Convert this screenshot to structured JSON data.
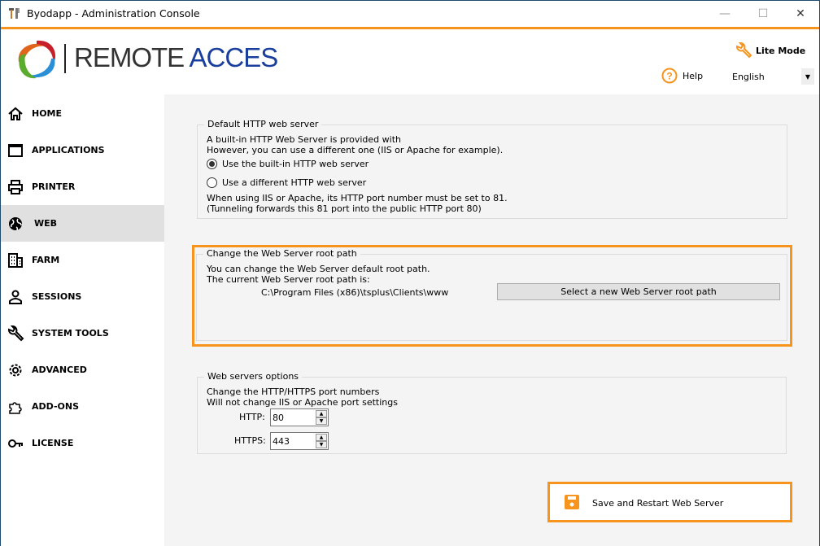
{
  "window": {
    "title": "Byodapp - Administration Console",
    "minimize": "—",
    "maximize": "☐",
    "close": "✕"
  },
  "header": {
    "logo_text_dark": "REMOTE",
    "logo_text_blue": "ACCES",
    "lite_mode": "Lite Mode",
    "help": "Help",
    "language": "English",
    "accent": "#f7941d"
  },
  "sidebar": {
    "items": [
      {
        "label": "HOME",
        "icon": "home-icon"
      },
      {
        "label": "APPLICATIONS",
        "icon": "window-icon"
      },
      {
        "label": "PRINTER",
        "icon": "printer-icon"
      },
      {
        "label": "WEB",
        "icon": "globe-icon",
        "selected": true
      },
      {
        "label": "FARM",
        "icon": "building-icon"
      },
      {
        "label": "SESSIONS",
        "icon": "user-icon"
      },
      {
        "label": "SYSTEM TOOLS",
        "icon": "wrench-icon"
      },
      {
        "label": "ADVANCED",
        "icon": "gear-icon"
      },
      {
        "label": "ADD-ONS",
        "icon": "puzzle-icon"
      },
      {
        "label": "LICENSE",
        "icon": "key-icon"
      }
    ]
  },
  "default_server": {
    "legend": "Default HTTP web server",
    "line1": "A built-in HTTP Web Server is provided with",
    "line2": "However, you can use a different one (IIS or Apache for example).",
    "radio_builtin": "Use the built-in HTTP web server",
    "radio_different": "Use a different HTTP web server",
    "selected": "builtin",
    "note1": "When using IIS or Apache, its HTTP port number must be set to 81.",
    "note2": "(Tunneling forwards this 81 port into the public HTTP port 80)"
  },
  "root_path": {
    "legend": "Change the Web Server root path",
    "line1": "You can change the Web Server default root path.",
    "line2": "The current Web Server root path is:",
    "path": "C:\\Program Files (x86)\\tsplus\\Clients\\www",
    "button": "Select a new Web Server root path"
  },
  "options": {
    "legend": "Web servers options",
    "line1": "Change the HTTP/HTTPS port numbers",
    "line2": "Will not change IIS or Apache port settings",
    "http_label": "HTTP:",
    "http_value": "80",
    "https_label": "HTTPS:",
    "https_value": "443"
  },
  "save_button": "Save and Restart Web Server"
}
